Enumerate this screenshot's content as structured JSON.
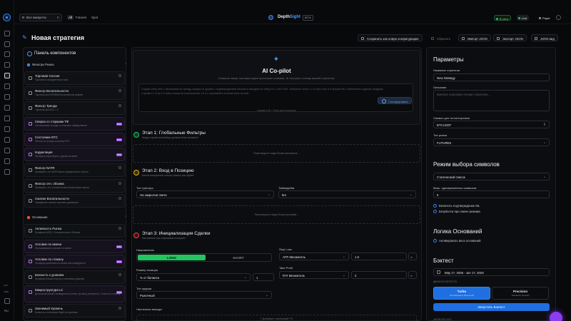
{
  "topbar": {
    "account": "Все аккаунты",
    "account_hint": "D",
    "tabs": [
      "All",
      "Futures",
      "Spot"
    ],
    "brand_a": "Depth",
    "brand_b": "Sight",
    "beta": "BETA",
    "inactive": "В сети",
    "live": "Live",
    "paper": "Paper"
  },
  "page": {
    "title": "Новая стратегия",
    "actions": [
      "Сохранить как новую конфигурацию",
      "Сбросить",
      "Импорт JSON",
      "Экспорт JSON",
      "JSON вид"
    ]
  },
  "left": {
    "title": "Панель компонентов",
    "sections": [
      {
        "label": "Фильтры Рынка"
      },
      {
        "label": "Основания"
      }
    ],
    "cards": [
      {
        "t": "Торговая Сессия",
        "d": "Торговля в определенные часы"
      },
      {
        "t": "Фильтр Волатильности",
        "d": "Торговля при ATR/BBW волатильном режиме"
      },
      {
        "t": "Фильтр Тренда",
        "d": "Торговля при ADX > X"
      },
      {
        "t": "Сверка со старшим ТФ",
        "d": "Согласование тренда со старшим таймфреймом"
      },
      {
        "t": "Состояние BTC",
        "d": "Фильтр по тренду или риску BTC"
      },
      {
        "t": "Корреляция",
        "d": "Проверка корреляции с другим активом"
      },
      {
        "t": "Фильтр NATR",
        "d": "Проверяет, что NATR выше определенного порога"
      },
      {
        "t": "Фильтр отн. объема",
        "d": "Проверяет, что относительный объем выше порога"
      },
      {
        "t": "Сжатие Волатильности",
        "d": "Определяет сжатие торгового диапазона"
      },
      {
        "t": "Активность Рынка",
        "d": "Проверка NATR / Относительного Объема"
      },
      {
        "t": "Условие по имени",
        "d": "Настраиваемое условие по имени"
      },
      {
        "t": "Условие по стакану",
        "d": "Проверка дисбаланса стакана или ликвидности"
      },
      {
        "t": "Близость к уровням",
        "d": "Проверка близости цены к ключевым уровням"
      },
      {
        "t": "Микроструктура L2",
        "d": "Детальный анализ ликвидности (стенки, spoofing, absorption). Только по стакану"
      },
      {
        "t": "Значимый Уровень",
        "d": "Близость к ключевым High/Low уровням"
      }
    ]
  },
  "copilot": {
    "title": "AI Co-pilot",
    "sub": "Опишите вашу торговую идею простыми словами. AI построит основу вашей стратегии.",
    "prompt": "Создай сетку лёгк с фильтрами по тренду, входом от уровня с подтверждением объема и выходом по тейку 1%, стоп 0.8%. Требуется сетка с 1.5 стоп-лосс в 5 процентов с трейлингом ордеров, ведущих к целям с 1.5 на 1.5 тейк-стопом на соотношении 1:3 и с торговлей в течение всех сессий...",
    "generate": "Сгенерировать",
    "hint": "Нажмите ⌘ + Enter для генерации"
  },
  "stages": [
    {
      "title": "Этап 1: Глобальные Фильтры",
      "sub": "Когда стратегия вообще должна быть активна?",
      "drop": "Перетащите сюда блоки фильтров..."
    },
    {
      "title": "Этап 2: Вход в Позицию",
      "sub": "Какой конкретный сигнал (status) мы ждём?",
      "drop": "Перетащите сюда блоки условий..."
    },
    {
      "title": "Этап 3: Инициализация Сделки",
      "sub": "Как именно мы открываем позицию?"
    }
  ],
  "stage2": {
    "trigger_label": "Тип триггера",
    "trigger": "На закрытии свечи",
    "tf_label": "Таймфрейм",
    "tf": "5m"
  },
  "stage3": {
    "dir_label": "Направление",
    "long": "LONG",
    "short": "SHORT",
    "size_label": "Размер позиции",
    "size_type": "% от баланса",
    "size": "1",
    "order_label": "Тип ордера",
    "order": "Рыночный",
    "partial": "Частичные выходы",
    "add_exit": "+ Добавить частичный ТП",
    "sl_label": "Stop Loss",
    "sl_type": "ATR Множитель",
    "sl": "1.5",
    "tp_label": "Take Profit",
    "tp_type": "R:R Множитель",
    "tp": "2"
  },
  "params": {
    "title": "Параметры",
    "name_label": "Название стратегии",
    "name": "New Strategy",
    "desc_label": "Описание",
    "desc_ph": "Краткое описание логики стратегии...",
    "sym_label": "Символ для теста/торговли",
    "sym": "BTCUSDT",
    "mkt_label": "Тип рынка",
    "mkt": "FUTURES"
  },
  "mode": {
    "title": "Режим выбора символов",
    "list": "Статический список",
    "max_label": "Макс. одновременных символов",
    "max": "5",
    "ml": "Включить подтверждение ML",
    "bu": "Безубыток при смене режима"
  },
  "logic": {
    "title": "Логика Оснований",
    "w": "Активировать веса оснований"
  },
  "bt": {
    "title": "Бэктест",
    "dates": "May 17, 2026 - Jun 17, 2026",
    "engine_label": "ДВИЖОК БЭКТЕСТА",
    "turbo": "Turbo",
    "turbo_s": "Оптимизация (Быстрый)",
    "prec": "Precision",
    "prec_s": "Тиковый (Точный)",
    "run": "Запустить Бэктест",
    "more": "ЗАПИСАТЬ ЛОГ..."
  },
  "rail": {
    "ver": "v1.5",
    "ver2": "PAS",
    "lang": "RU"
  },
  "colors": {
    "accent": "#1f6fe0",
    "long": "#22c55e",
    "pro": "#9d4df0"
  }
}
